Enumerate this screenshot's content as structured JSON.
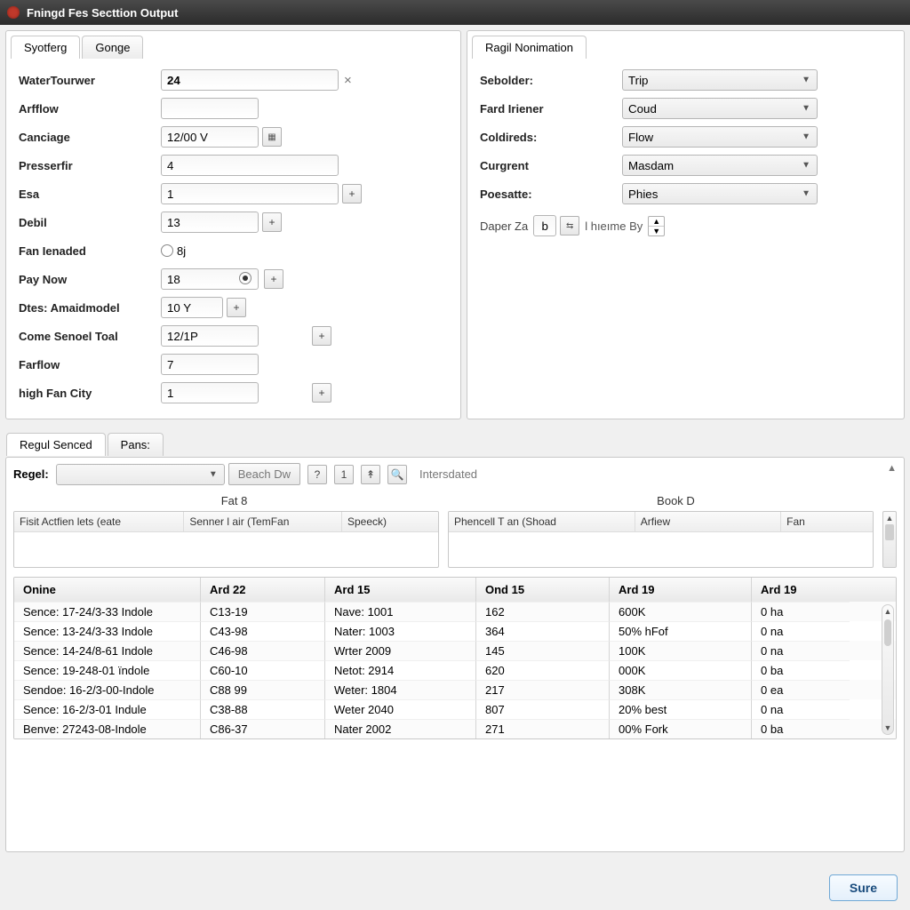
{
  "window": {
    "title": "Fningd Fes Secttion Output"
  },
  "left_panel": {
    "tabs": [
      "Syotferg",
      "Gonge"
    ],
    "active_tab": 0,
    "fields": {
      "water_torwer": {
        "label": "WaterTourwer",
        "value": "24"
      },
      "arfflow": {
        "label": "Arfflow",
        "value": ""
      },
      "canciage": {
        "label": "Canciage",
        "value": "12/00 V"
      },
      "pressertir": {
        "label": "Presserfir",
        "value": "4"
      },
      "esa": {
        "label": "Esa",
        "value": "1"
      },
      "debil": {
        "label": "Debil",
        "value": "13"
      },
      "fan_ienaded": {
        "label": "Fan Ienaded",
        "value": "8j"
      },
      "pay_now": {
        "label": "Pay Now",
        "value": "18"
      },
      "amaidmodel": {
        "label": "Dtes: Amaidmodel",
        "value": "10 Y"
      },
      "come_senoel": {
        "label": "Come Senoel Toal",
        "value": "12/1P"
      },
      "farflow": {
        "label": "Farflow",
        "value": "7"
      },
      "high_fan_city": {
        "label": "high Fan City",
        "value": "1"
      }
    }
  },
  "right_panel": {
    "tab_label": "Ragil Nonimation",
    "fields": {
      "sebolder": {
        "label": "Sebolder:",
        "value": "Trip"
      },
      "fard_iriener": {
        "label": "Fard Iriener",
        "value": "Coud"
      },
      "coldireds": {
        "label": "Coldireds:",
        "value": "Flow"
      },
      "curgrent": {
        "label": "Curgrent",
        "value": "Masdam"
      },
      "poesatte": {
        "label": "Poesatte:",
        "value": "Phies"
      }
    },
    "daper": {
      "label": "Daper Za",
      "value": "b",
      "suffix": "l hıeıme By"
    }
  },
  "lower": {
    "tabs": [
      "Regul Senced",
      "Pans:"
    ],
    "active_tab": 0,
    "regel_label": "Regel:",
    "regel_value": "",
    "beach_button": "Beach Dw",
    "status_text": "Intersdated",
    "fat8_title": "Fat 8",
    "bookd_title": "Book D",
    "fat8_cols": [
      "Fisit Actfien lets (eate",
      "Senner l air (TemFan",
      "Speeck)"
    ],
    "bookd_cols": [
      "Phencell T an (Shoad",
      "Arfiew",
      "Fan"
    ]
  },
  "grid": {
    "headers": [
      "Onine",
      "Ard 22",
      "Ard 15",
      "Ond 15",
      "Ard 19",
      "Ard 19"
    ],
    "rows": [
      [
        "Sence: 17-24/3-33 Indole",
        "C13-19",
        "Nave: 1001",
        "162",
        "600K",
        "0 ha"
      ],
      [
        "Sence: 13-24/3-33 Indole",
        "C43-98",
        "Nater: 1003",
        "364",
        "50% hFof",
        "0 na"
      ],
      [
        "Sence: 14-24/8-61 Indole",
        "C46-98",
        "Wrter 2009",
        "145",
        "100K",
        "0 na"
      ],
      [
        "Sence: 19-248-01 ïndole",
        "C60-10",
        "Netot: 2914",
        "620",
        "000K",
        "0 ba"
      ],
      [
        "Sendoe: 16-2/3-00-Indole",
        "C88 99",
        "Weter: 1804",
        "217",
        "308K",
        "0 ea"
      ],
      [
        "Sence: 16-2/3-01 Indule",
        "C38-88",
        "Weter 2040",
        "807",
        "20% best",
        "0 na"
      ],
      [
        "Benve: 27243-08-Indole",
        "C86-37",
        "Nater 2002",
        "271",
        "00% Fork",
        "0 ba"
      ]
    ]
  },
  "footer": {
    "sure": "Sure"
  }
}
